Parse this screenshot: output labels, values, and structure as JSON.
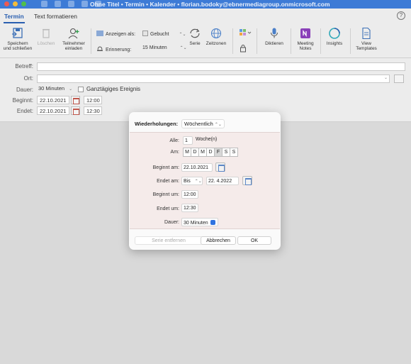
{
  "window": {
    "title": "Ohne Titel • Termin • Kalender • florian.bodoky@ebnermediagroup.onmicrosoft.com"
  },
  "tabs": [
    {
      "label": "Termin",
      "active": true
    },
    {
      "label": "Text formatieren",
      "active": false
    }
  ],
  "help_label": "?",
  "ribbon": {
    "save": {
      "line1": "Speichern",
      "line2": "und schließen"
    },
    "delete": {
      "label": "Löschen"
    },
    "invite": {
      "line1": "Teilnehmer",
      "line2": "einladen"
    },
    "show_as": {
      "label": "Anzeigen als:",
      "value": "Gebucht"
    },
    "reminder": {
      "label": "Erinnerung:",
      "value": "15 Minuten"
    },
    "series": {
      "label": "Serie"
    },
    "timezones": {
      "label": "Zeitzonen"
    },
    "dictate": {
      "label": "Diktieren"
    },
    "meeting_notes": {
      "line1": "Meeting",
      "line2": "Notes"
    },
    "insights": {
      "label": "Insights"
    },
    "view_templates": {
      "line1": "View",
      "line2": "Templates"
    }
  },
  "form": {
    "subject_label": "Betreff:",
    "location_label": "Ort:",
    "duration_label": "Dauer:",
    "duration_value": "30 Minuten",
    "allday_label": "Ganztägiges Ereignis",
    "start_label": "Beginnt:",
    "start_date": "22.10.2021",
    "start_time": "12:00",
    "end_label": "Endet:",
    "end_date": "22.10.2021",
    "end_time": "12:30"
  },
  "dialog": {
    "repeat_label": "Wiederholungen:",
    "repeat_value": "Wöchentlich",
    "every_label": "Alle:",
    "every_value": "1",
    "every_unit": "Woche(n)",
    "on_label": "Am:",
    "days": [
      {
        "label": "M",
        "selected": false
      },
      {
        "label": "D",
        "selected": false
      },
      {
        "label": "M",
        "selected": false
      },
      {
        "label": "D",
        "selected": false
      },
      {
        "label": "F",
        "selected": true
      },
      {
        "label": "S",
        "selected": false
      },
      {
        "label": "S",
        "selected": false
      }
    ],
    "starts_label": "Beginnt am:",
    "starts_value": "22.10.2021",
    "ends_label": "Endet am:",
    "ends_mode": "Bis",
    "ends_value": "22.  4.2022",
    "start_time_label": "Beginnt um:",
    "start_time_value": "12:00",
    "end_time_label": "Endet um:",
    "end_time_value": "12:30",
    "duration_label": "Dauer:",
    "duration_value": "30 Minuten",
    "remove_series": "Serie entfernen",
    "cancel": "Abbrechen",
    "ok": "OK"
  },
  "colors": {
    "titlebar": "#3d7bd6",
    "accent": "#2a5fb0",
    "dialog_body": "#f5ebea"
  }
}
